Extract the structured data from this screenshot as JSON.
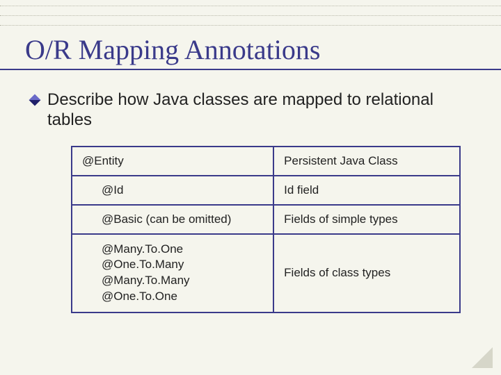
{
  "title": "O/R Mapping Annotations",
  "bullet": "Describe how Java classes are mapped to relational tables",
  "table": {
    "rows": [
      {
        "left": "@Entity",
        "right": "Persistent Java Class",
        "indent": false,
        "multi": false
      },
      {
        "left": "@Id",
        "right": "Id field",
        "indent": true,
        "multi": false
      },
      {
        "left": "@Basic (can be omitted)",
        "right": "Fields of simple types",
        "indent": true,
        "multi": false
      },
      {
        "left": "@Many.To.One\n@One.To.Many\n@Many.To.Many\n@One.To.One",
        "right": "Fields of class types",
        "indent": true,
        "multi": true
      }
    ]
  }
}
